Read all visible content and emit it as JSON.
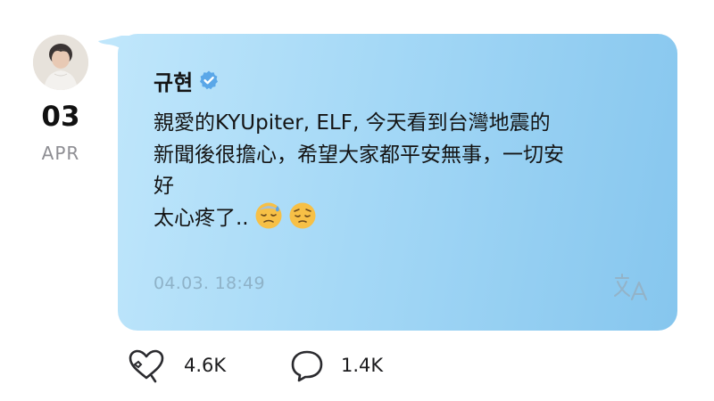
{
  "post": {
    "date": {
      "day": "03",
      "month": "APR"
    },
    "sender": {
      "name": "규현",
      "verified": true
    },
    "message_lines": [
      "親愛的KYUpiter, ELF, 今天看到台灣地震的",
      "新聞後很擔心，希望大家都平安無事，一切安",
      "好",
      "太心疼了.."
    ],
    "emoji": [
      "downcast-face-with-sweat",
      "pensive-face"
    ],
    "timestamp": "04.03. 18:49",
    "translate_icon": "translate-icon"
  },
  "actions": {
    "likes": {
      "icon": "heart-sparkle-icon",
      "count": "4.6K"
    },
    "comments": {
      "icon": "comment-bubble-icon",
      "count": "1.4K"
    }
  },
  "colors": {
    "bubble_start": "#bfe6fb",
    "bubble_end": "#86c6ee",
    "verified": "#5aa7e8",
    "timestamp": "#8eb2c8"
  }
}
